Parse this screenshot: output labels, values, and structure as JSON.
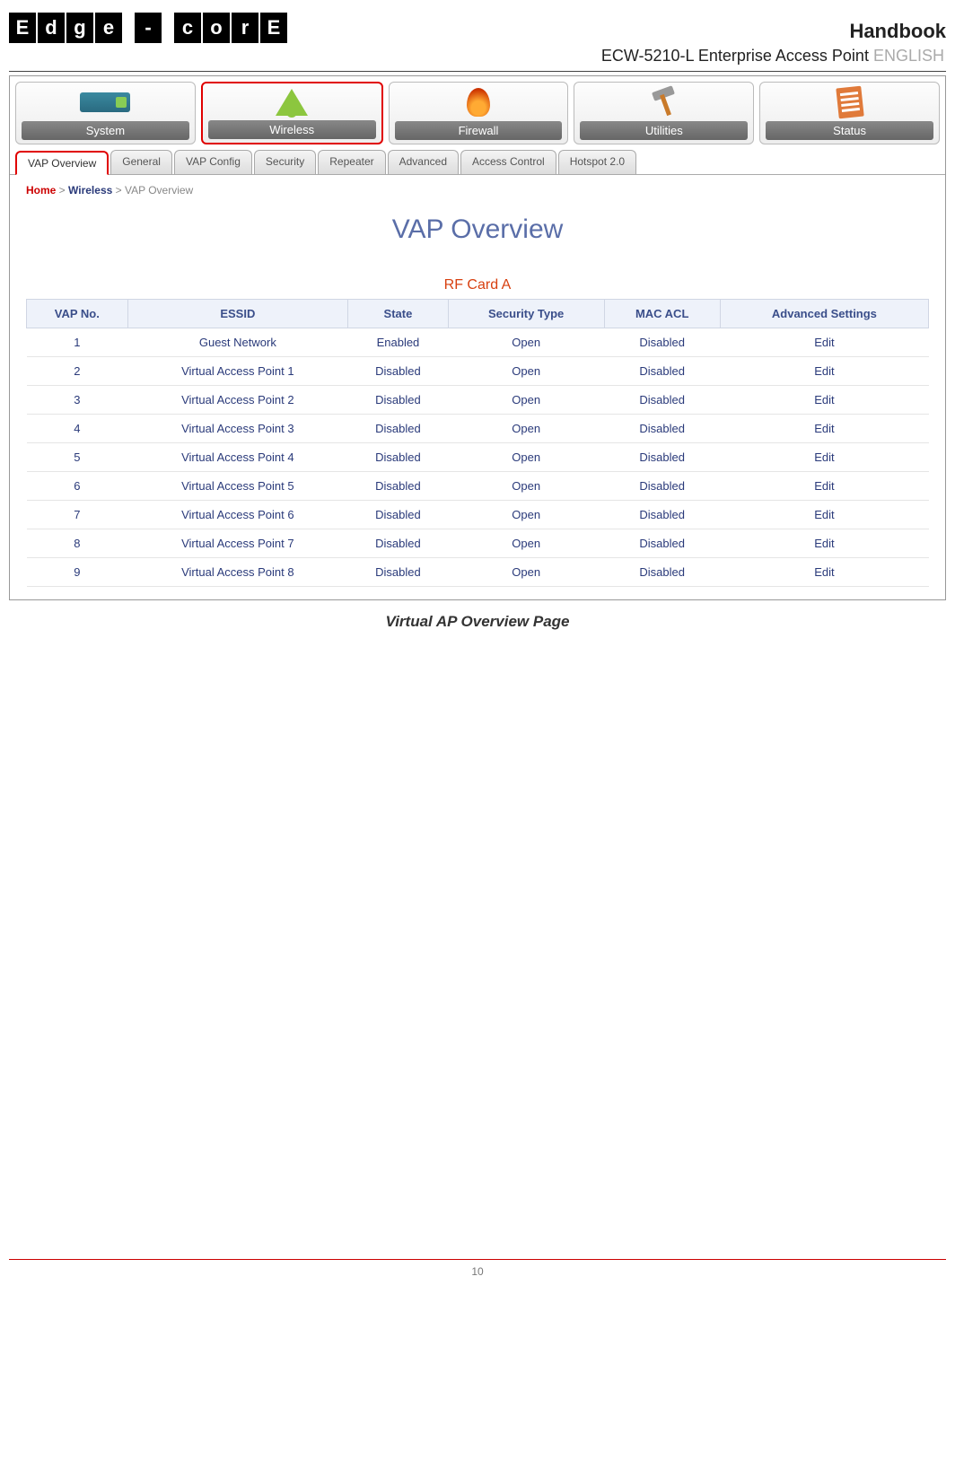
{
  "header": {
    "logo_chars": [
      "E",
      "d",
      "g",
      "e",
      "-",
      "c",
      "o",
      "r",
      "E"
    ],
    "handbook": "Handbook",
    "device": "ECW-5210-L Enterprise Access Point",
    "lang": "ENGLISH"
  },
  "main_nav": [
    {
      "id": "system",
      "label": "System",
      "highlight": false,
      "icon": "router-icon"
    },
    {
      "id": "wireless",
      "label": "Wireless",
      "highlight": true,
      "icon": "wifi-icon"
    },
    {
      "id": "firewall",
      "label": "Firewall",
      "highlight": false,
      "icon": "firewall-icon"
    },
    {
      "id": "utilities",
      "label": "Utilities",
      "highlight": false,
      "icon": "hammer-icon"
    },
    {
      "id": "status",
      "label": "Status",
      "highlight": false,
      "icon": "status-icon"
    }
  ],
  "sub_tabs": [
    {
      "label": "VAP Overview",
      "active": true
    },
    {
      "label": "General",
      "active": false
    },
    {
      "label": "VAP Config",
      "active": false
    },
    {
      "label": "Security",
      "active": false
    },
    {
      "label": "Repeater",
      "active": false
    },
    {
      "label": "Advanced",
      "active": false
    },
    {
      "label": "Access Control",
      "active": false
    },
    {
      "label": "Hotspot 2.0",
      "active": false
    }
  ],
  "breadcrumb": {
    "home": "Home",
    "sep": " > ",
    "wireless": "Wireless",
    "tail": " > VAP Overview"
  },
  "page_title": "VAP Overview",
  "rf_card": "RF Card A",
  "table": {
    "headers": [
      "VAP No.",
      "ESSID",
      "State",
      "Security Type",
      "MAC ACL",
      "Advanced Settings"
    ],
    "rows": [
      {
        "no": "1",
        "essid": "Guest Network",
        "state": "Enabled",
        "sec": "Open",
        "acl": "Disabled",
        "adv": "Edit"
      },
      {
        "no": "2",
        "essid": "Virtual Access Point 1",
        "state": "Disabled",
        "sec": "Open",
        "acl": "Disabled",
        "adv": "Edit"
      },
      {
        "no": "3",
        "essid": "Virtual Access Point 2",
        "state": "Disabled",
        "sec": "Open",
        "acl": "Disabled",
        "adv": "Edit"
      },
      {
        "no": "4",
        "essid": "Virtual Access Point 3",
        "state": "Disabled",
        "sec": "Open",
        "acl": "Disabled",
        "adv": "Edit"
      },
      {
        "no": "5",
        "essid": "Virtual Access Point 4",
        "state": "Disabled",
        "sec": "Open",
        "acl": "Disabled",
        "adv": "Edit"
      },
      {
        "no": "6",
        "essid": "Virtual Access Point 5",
        "state": "Disabled",
        "sec": "Open",
        "acl": "Disabled",
        "adv": "Edit"
      },
      {
        "no": "7",
        "essid": "Virtual Access Point 6",
        "state": "Disabled",
        "sec": "Open",
        "acl": "Disabled",
        "adv": "Edit"
      },
      {
        "no": "8",
        "essid": "Virtual Access Point 7",
        "state": "Disabled",
        "sec": "Open",
        "acl": "Disabled",
        "adv": "Edit"
      },
      {
        "no": "9",
        "essid": "Virtual Access Point 8",
        "state": "Disabled",
        "sec": "Open",
        "acl": "Disabled",
        "adv": "Edit"
      }
    ]
  },
  "caption": "Virtual AP Overview Page",
  "page_number": "10"
}
